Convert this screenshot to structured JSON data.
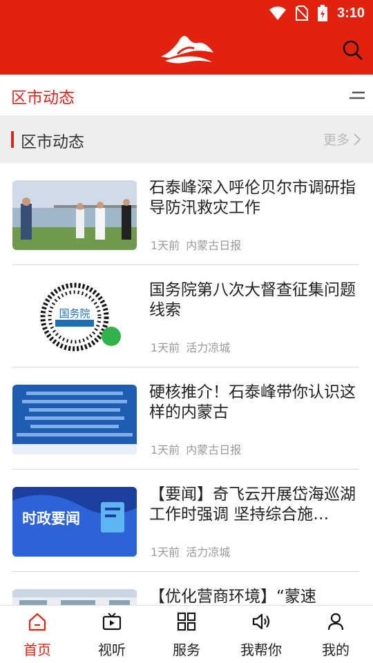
{
  "status_bar": {
    "time": "3:10"
  },
  "header": {
    "logo_icon": "mountain-logo-icon",
    "search_icon": "search-icon"
  },
  "channel": {
    "title": "区市动态",
    "menu_icon": "menu-lines-icon"
  },
  "section": {
    "title": "区市动态",
    "more_label": "更多"
  },
  "news": [
    {
      "title": "石泰峰深入呼伦贝尔市调研指导防汛救灾工作",
      "time": "1天前",
      "source": "内蒙古日报",
      "thumb": "river-officials-photo"
    },
    {
      "title": "国务院第八次大督查征集问题线索",
      "time": "1天前",
      "source": "活力凉城",
      "thumb": "qr-code-image",
      "thumb_label": "国务院"
    },
    {
      "title": "硬核推介！石泰峰带你认识这样的内蒙古",
      "time": "1天前",
      "source": "内蒙古日报",
      "thumb": "blue-text-banner"
    },
    {
      "title": "【要闻】奇飞云开展岱海巡湖工作时强调 坚持综合施…",
      "time": "1天前",
      "source": "活力凉城",
      "thumb": "politics-news-banner",
      "thumb_label": "时政要闻"
    },
    {
      "title": "【优化营商环境】“蒙速",
      "time": "",
      "source": "",
      "thumb": "building-photo"
    }
  ],
  "bottom_nav": [
    {
      "label": "首页",
      "icon": "home-icon",
      "active": true
    },
    {
      "label": "视听",
      "icon": "tv-icon",
      "active": false
    },
    {
      "label": "服务",
      "icon": "grid-icon",
      "active": false
    },
    {
      "label": "我帮你",
      "icon": "speaker-icon",
      "active": false
    },
    {
      "label": "我的",
      "icon": "user-icon",
      "active": false
    }
  ],
  "colors": {
    "brand_red": "#e0220f",
    "accent_red": "#d9261c",
    "text_gray": "#999999"
  }
}
